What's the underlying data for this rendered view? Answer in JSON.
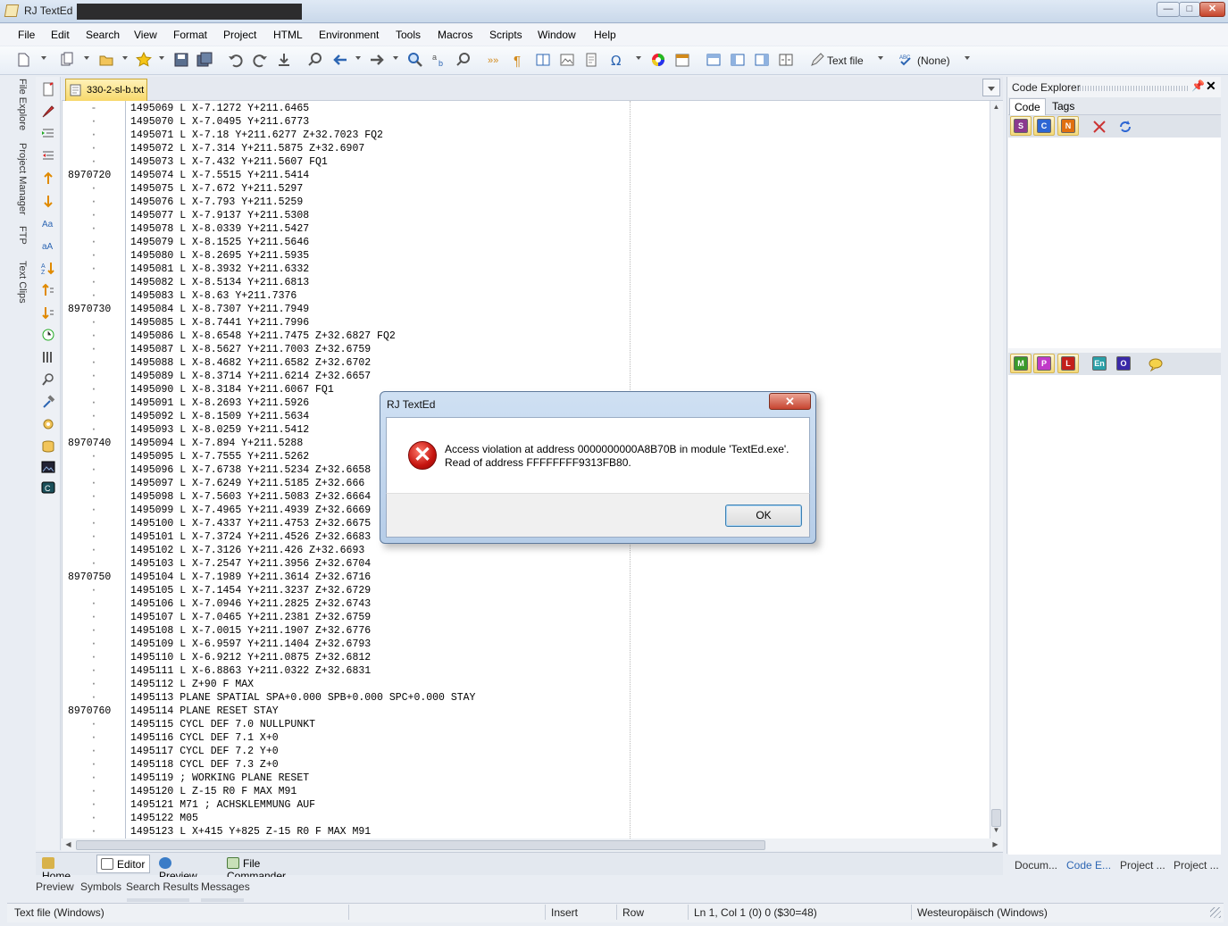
{
  "window": {
    "title": "RJ TextEd",
    "minimize": "—",
    "maximize": "□",
    "close": "✕"
  },
  "menu": [
    "File",
    "Edit",
    "Search",
    "View",
    "Format",
    "Project",
    "HTML",
    "Environment",
    "Tools",
    "Macros",
    "Scripts",
    "Window",
    "Help"
  ],
  "toolbar": {
    "highlighter": "Text file",
    "spellcheck": "(None)"
  },
  "side_tabs": [
    "File Explore",
    "Project Manager",
    "FTP",
    "Text Clips"
  ],
  "document_tab": "330-2-sl-b.txt",
  "editor": {
    "lines": [
      {
        "g": "-",
        "t": "1495069 L X-7.1272 Y+211.6465"
      },
      {
        "g": "·",
        "t": "1495070 L X-7.0495 Y+211.6773"
      },
      {
        "g": "·",
        "t": "1495071 L X-7.18 Y+211.6277 Z+32.7023 FQ2"
      },
      {
        "g": "·",
        "t": "1495072 L X-7.314 Y+211.5875 Z+32.6907"
      },
      {
        "g": "·",
        "t": "1495073 L X-7.432 Y+211.5607 FQ1"
      },
      {
        "g": "8970720",
        "t": "1495074 L X-7.5515 Y+211.5414"
      },
      {
        "g": "·",
        "t": "1495075 L X-7.672 Y+211.5297"
      },
      {
        "g": "·",
        "t": "1495076 L X-7.793 Y+211.5259"
      },
      {
        "g": "·",
        "t": "1495077 L X-7.9137 Y+211.5308"
      },
      {
        "g": "·",
        "t": "1495078 L X-8.0339 Y+211.5427"
      },
      {
        "g": "·",
        "t": "1495079 L X-8.1525 Y+211.5646"
      },
      {
        "g": "·",
        "t": "1495080 L X-8.2695 Y+211.5935"
      },
      {
        "g": "·",
        "t": "1495081 L X-8.3932 Y+211.6332"
      },
      {
        "g": "·",
        "t": "1495082 L X-8.5134 Y+211.6813"
      },
      {
        "g": "·",
        "t": "1495083 L X-8.63 Y+211.7376"
      },
      {
        "g": "8970730",
        "t": "1495084 L X-8.7307 Y+211.7949"
      },
      {
        "g": "·",
        "t": "1495085 L X-8.7441 Y+211.7996"
      },
      {
        "g": "·",
        "t": "1495086 L X-8.6548 Y+211.7475 Z+32.6827 FQ2"
      },
      {
        "g": "·",
        "t": "1495087 L X-8.5627 Y+211.7003 Z+32.6759"
      },
      {
        "g": "·",
        "t": "1495088 L X-8.4682 Y+211.6582 Z+32.6702"
      },
      {
        "g": "·",
        "t": "1495089 L X-8.3714 Y+211.6214 Z+32.6657"
      },
      {
        "g": "·",
        "t": "1495090 L X-8.3184 Y+211.6067 FQ1"
      },
      {
        "g": "·",
        "t": "1495091 L X-8.2693 Y+211.5926"
      },
      {
        "g": "·",
        "t": "1495092 L X-8.1509 Y+211.5634"
      },
      {
        "g": "·",
        "t": "1495093 L X-8.0259 Y+211.5412"
      },
      {
        "g": "8970740",
        "t": "1495094 L X-7.894 Y+211.5288"
      },
      {
        "g": "·",
        "t": "1495095 L X-7.7555 Y+211.5262"
      },
      {
        "g": "·",
        "t": "1495096 L X-7.6738 Y+211.5234 Z+32.6658"
      },
      {
        "g": "·",
        "t": "1495097 L X-7.6249 Y+211.5185 Z+32.666"
      },
      {
        "g": "·",
        "t": "1495098 L X-7.5603 Y+211.5083 Z+32.6664"
      },
      {
        "g": "·",
        "t": "1495099 L X-7.4965 Y+211.4939 Z+32.6669"
      },
      {
        "g": "·",
        "t": "1495100 L X-7.4337 Y+211.4753 Z+32.6675"
      },
      {
        "g": "·",
        "t": "1495101 L X-7.3724 Y+211.4526 Z+32.6683"
      },
      {
        "g": "·",
        "t": "1495102 L X-7.3126 Y+211.426 Z+32.6693"
      },
      {
        "g": "·",
        "t": "1495103 L X-7.2547 Y+211.3956 Z+32.6704"
      },
      {
        "g": "8970750",
        "t": "1495104 L X-7.1989 Y+211.3614 Z+32.6716"
      },
      {
        "g": "·",
        "t": "1495105 L X-7.1454 Y+211.3237 Z+32.6729"
      },
      {
        "g": "·",
        "t": "1495106 L X-7.0946 Y+211.2825 Z+32.6743"
      },
      {
        "g": "·",
        "t": "1495107 L X-7.0465 Y+211.2381 Z+32.6759"
      },
      {
        "g": "·",
        "t": "1495108 L X-7.0015 Y+211.1907 Z+32.6776"
      },
      {
        "g": "·",
        "t": "1495109 L X-6.9597 Y+211.1404 Z+32.6793"
      },
      {
        "g": "·",
        "t": "1495110 L X-6.9212 Y+211.0875 Z+32.6812"
      },
      {
        "g": "·",
        "t": "1495111 L X-6.8863 Y+211.0322 Z+32.6831"
      },
      {
        "g": "·",
        "t": "1495112 L Z+90 F MAX"
      },
      {
        "g": "·",
        "t": "1495113 PLANE SPATIAL SPA+0.000 SPB+0.000 SPC+0.000 STAY"
      },
      {
        "g": "8970760",
        "t": "1495114 PLANE RESET STAY"
      },
      {
        "g": "·",
        "t": "1495115 CYCL DEF 7.0 NULLPUNKT"
      },
      {
        "g": "·",
        "t": "1495116 CYCL DEF 7.1 X+0"
      },
      {
        "g": "·",
        "t": "1495117 CYCL DEF 7.2 Y+0"
      },
      {
        "g": "·",
        "t": "1495118 CYCL DEF 7.3 Z+0"
      },
      {
        "g": "·",
        "t": "1495119 ; WORKING PLANE RESET"
      },
      {
        "g": "·",
        "t": "1495120 L Z-15 R0 F MAX M91"
      },
      {
        "g": "·",
        "t": "1495121 M71 ; ACHSKLEMMUNG AUF"
      },
      {
        "g": "·",
        "t": "1495122 M05"
      },
      {
        "g": "·",
        "t": "1495123 L X+415 Y+825 Z-15 R0 F MAX M91"
      }
    ]
  },
  "bottom_tabs": [
    "Home",
    "Editor",
    "Preview",
    "File Commander"
  ],
  "sub_tabs": [
    "Preview",
    "Symbols",
    "Search Results",
    "Messages"
  ],
  "status": {
    "filetype": "Text file (Windows)",
    "mode": "Insert",
    "row": "Row",
    "position": "Ln 1, Col 1 (0) 0 ($30=48)",
    "encoding": "Westeuropäisch (Windows)"
  },
  "code_explorer": {
    "title": "Code Explorer",
    "tabs": [
      "Code",
      "Tags"
    ],
    "toolbar1": [
      "S",
      "C",
      "N"
    ],
    "toolbar2": [
      "M",
      "P",
      "L",
      "En",
      "O"
    ],
    "bottom_tabs": [
      "Docum...",
      "Code E...",
      "Project ...",
      "Project ..."
    ]
  },
  "dialog": {
    "title": "RJ TextEd",
    "close": "✕",
    "message_line1": "Access violation at address 0000000000A8B70B in module 'TextEd.exe'.",
    "message_line2": "Read of address FFFFFFFF9313FB80.",
    "ok_label": "OK",
    "icon": "error-icon"
  }
}
